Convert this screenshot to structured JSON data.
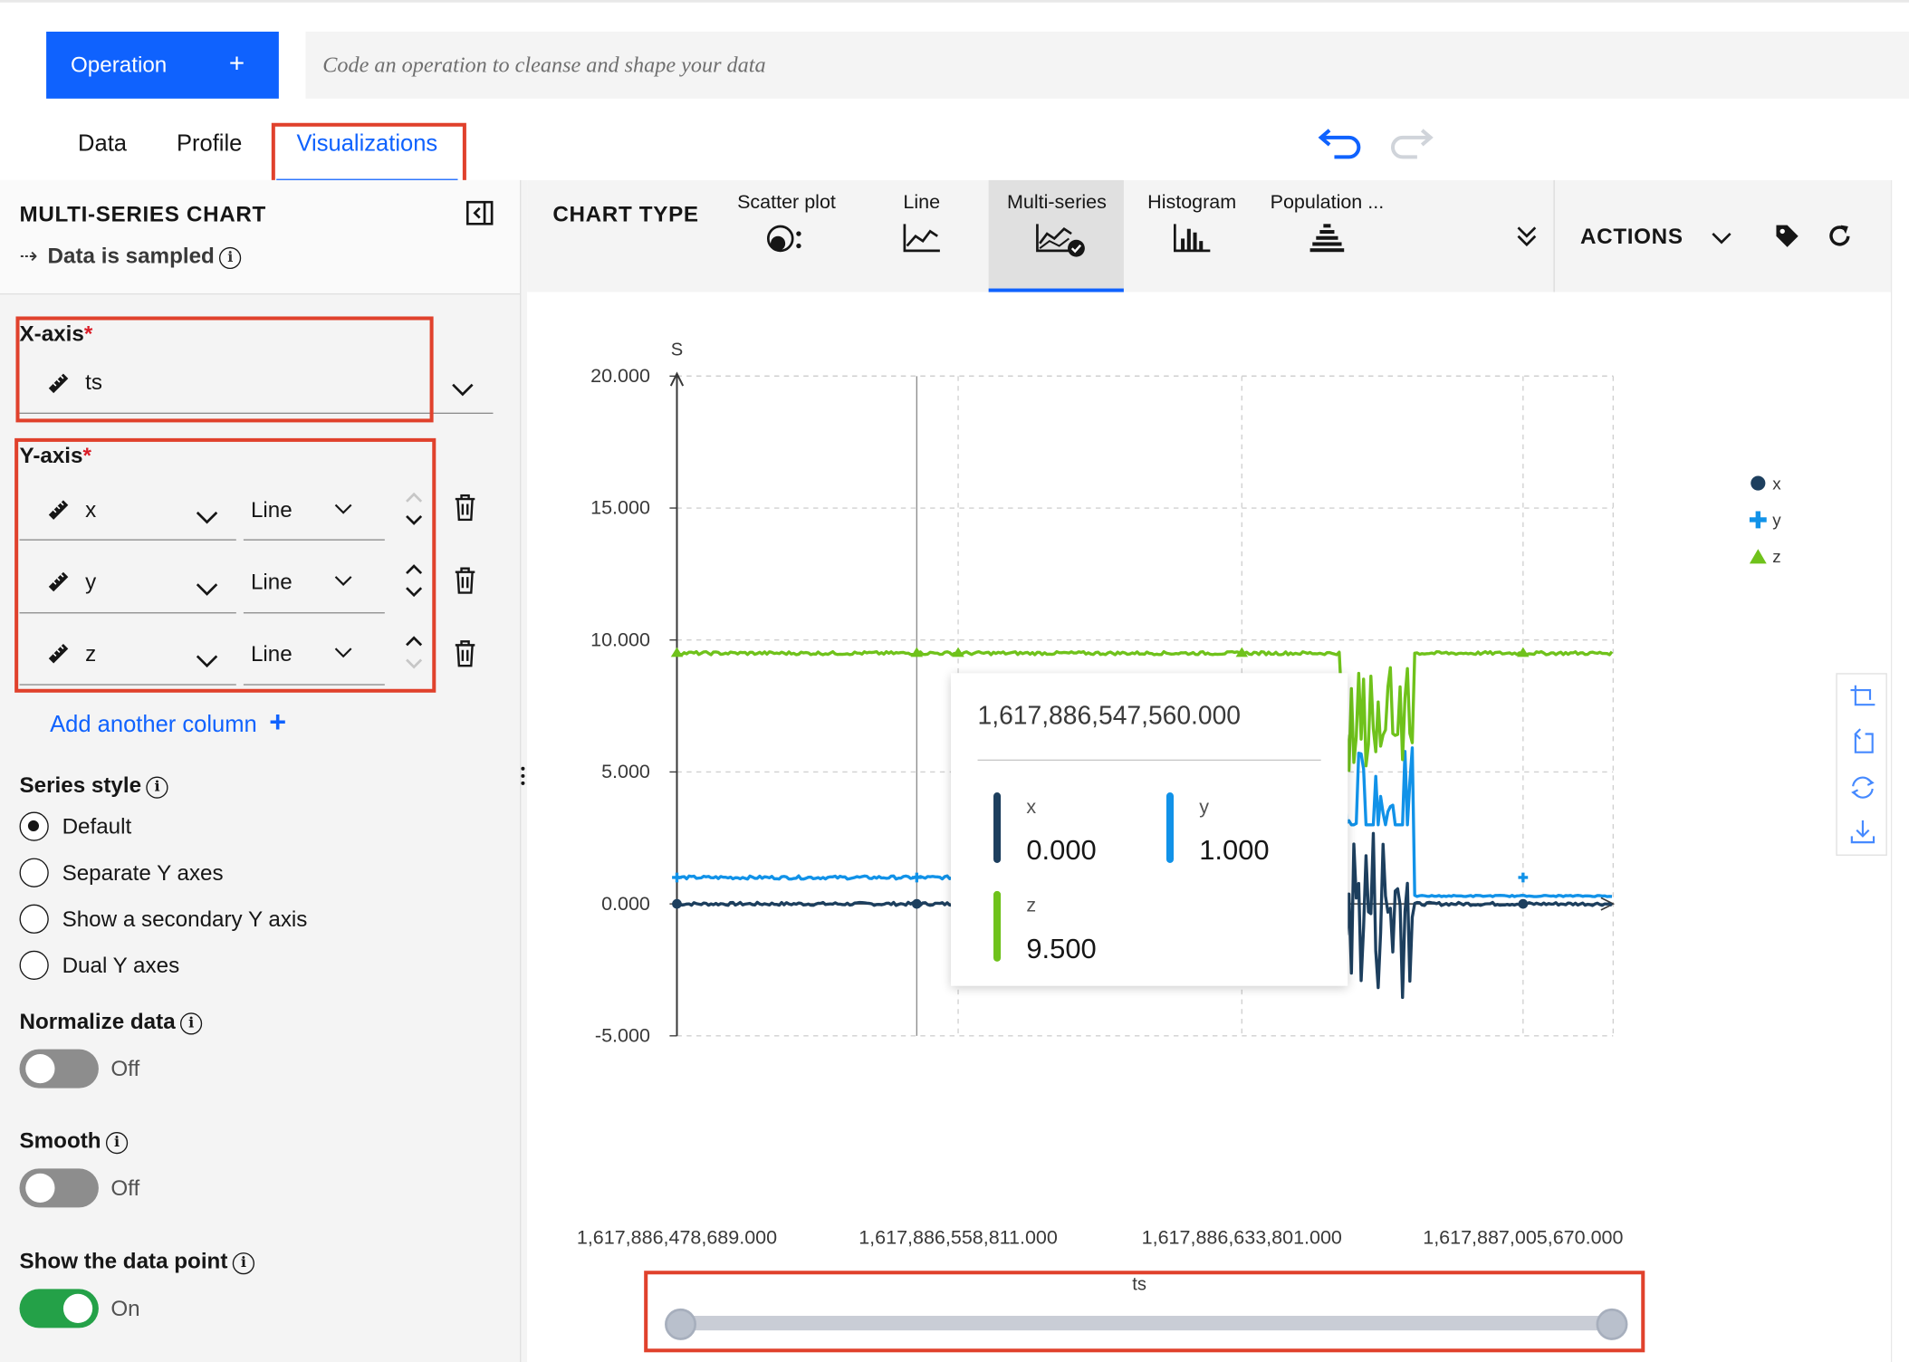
{
  "header": {
    "operation_label": "Operation",
    "operation_plus": "+",
    "code_placeholder": "Code an operation to cleanse and shape your data"
  },
  "tabs": [
    {
      "label": "Data"
    },
    {
      "label": "Profile"
    },
    {
      "label": "Visualizations",
      "active": true
    }
  ],
  "left_panel": {
    "title": "MULTI-SERIES CHART",
    "sampled_arrow": "⇢",
    "sampled_label": "Data is sampled",
    "x_axis": {
      "label": "X-axis",
      "required": "*",
      "value": "ts"
    },
    "y_axis": {
      "label": "Y-axis",
      "required": "*",
      "rows": [
        {
          "column": "x",
          "style": "Line"
        },
        {
          "column": "y",
          "style": "Line"
        },
        {
          "column": "z",
          "style": "Line"
        }
      ]
    },
    "add_column_label": "Add another column",
    "add_column_plus": "+",
    "series_style": {
      "label": "Series style",
      "options": [
        "Default",
        "Separate Y axes",
        "Show a secondary Y axis",
        "Dual Y axes"
      ],
      "selected": "Default"
    },
    "normalize": {
      "label": "Normalize data",
      "state": "Off"
    },
    "smooth": {
      "label": "Smooth",
      "state": "Off"
    },
    "show_point": {
      "label": "Show the data point",
      "state": "On"
    }
  },
  "toolbar": {
    "chart_type_label": "CHART TYPE",
    "types": [
      "Scatter plot",
      "Line",
      "Multi-series",
      "Histogram",
      "Population ..."
    ],
    "active_type": "Multi-series",
    "actions_label": "ACTIONS"
  },
  "chart_data": {
    "type": "line",
    "ylabel": "S",
    "xlabel": "ts",
    "ylim": [
      -5,
      20
    ],
    "y_ticks": [
      "20.000",
      "15.000",
      "10.000",
      "5.000",
      "0.000",
      "-5.000"
    ],
    "x_ticks": [
      "1,617,886,478,689.000",
      "1,617,886,558,811.000",
      "1,617,886,633,801.000",
      "1,617,887,005,670.000"
    ],
    "grid": true,
    "legend_position": "right",
    "series": [
      {
        "name": "x",
        "color": "#1d3f5e",
        "marker": "circle",
        "baseline": 0.0
      },
      {
        "name": "y",
        "color": "#1192e8",
        "marker": "plus",
        "baseline": 1.0
      },
      {
        "name": "z",
        "color": "#6fc21b",
        "marker": "triangle",
        "baseline": 9.5
      }
    ],
    "tooltip": {
      "title": "1,617,886,547,560.000",
      "entries": [
        {
          "name": "x",
          "value": "0.000",
          "color": "#1d3f5e"
        },
        {
          "name": "y",
          "value": "1.000",
          "color": "#1192e8"
        },
        {
          "name": "z",
          "value": "9.500",
          "color": "#6fc21b"
        }
      ]
    }
  },
  "slider": {
    "label": "ts"
  }
}
